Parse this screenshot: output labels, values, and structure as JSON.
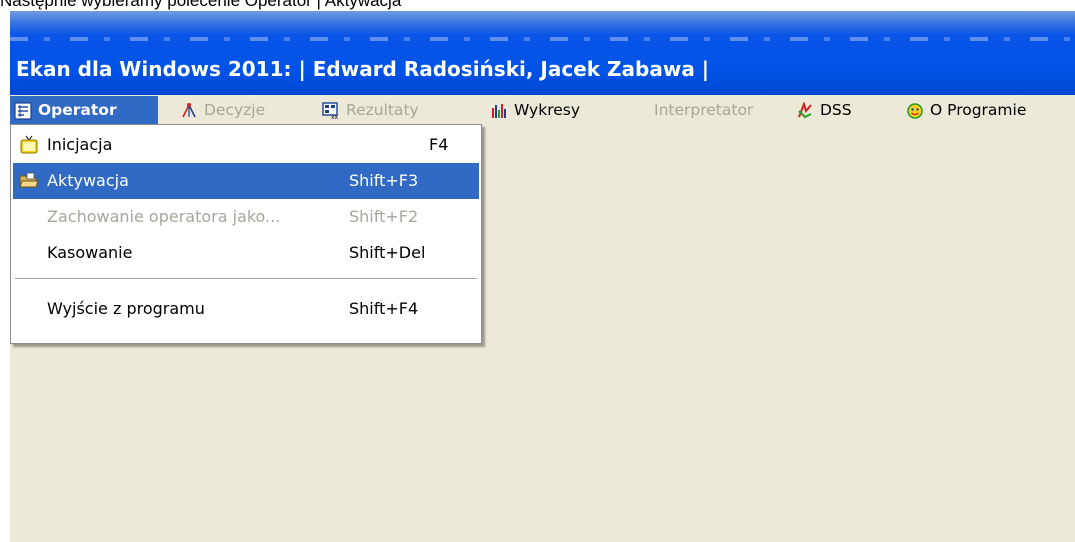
{
  "caption": "Następnie wybieramy polecenie Operator | Aktywacja",
  "window": {
    "title": "Ekan dla Windows 2011:  | Edward Radosiński, Jacek Zabawa |"
  },
  "menubar": {
    "items": [
      {
        "label": "Operator",
        "icon": "operator-icon",
        "state": "active"
      },
      {
        "label": "Decyzje",
        "icon": "decision-tree-icon",
        "state": "disabled"
      },
      {
        "label": "Rezultaty",
        "icon": "results-table-icon",
        "state": "disabled"
      },
      {
        "label": "Wykresy",
        "icon": "bar-chart-icon",
        "state": "enabled"
      },
      {
        "label": "Interpretator",
        "icon": "",
        "state": "disabled"
      },
      {
        "label": "DSS",
        "icon": "dss-icon",
        "state": "enabled"
      },
      {
        "label": "O Programie",
        "icon": "about-icon",
        "state": "enabled"
      }
    ]
  },
  "dropdown": {
    "items": [
      {
        "label": "Inicjacja",
        "shortcut": "F4",
        "icon": "tv-icon",
        "state": "enabled"
      },
      {
        "label": "Aktywacja",
        "shortcut": "Shift+F3",
        "icon": "open-folder-icon",
        "state": "highlighted"
      },
      {
        "label": "Zachowanie operatora jako...",
        "shortcut": "Shift+F2",
        "icon": "",
        "state": "disabled"
      },
      {
        "label": "Kasowanie",
        "shortcut": "Shift+Del",
        "icon": "",
        "state": "enabled"
      },
      {
        "label": "Wyjście z programu",
        "shortcut": "Shift+F4",
        "icon": "",
        "state": "enabled"
      }
    ]
  },
  "colors": {
    "titlebar": "#0053e6",
    "highlight": "#316ac5",
    "menu_bg": "#ece9d8",
    "disabled_text": "#a7a69a"
  }
}
